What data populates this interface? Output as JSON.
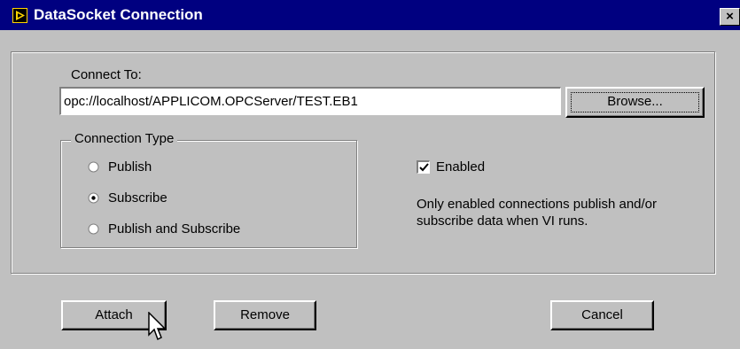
{
  "window": {
    "title": "DataSocket Connection",
    "close_glyph": "×",
    "icon": "labview-icon"
  },
  "connect": {
    "label": "Connect To:",
    "url_value": "opc://localhost/APPLICOM.OPCServer/TEST.EB1",
    "browse_label": "Browse..."
  },
  "connection_type": {
    "legend": "Connection Type",
    "options": [
      {
        "label": "Publish",
        "selected": false
      },
      {
        "label": "Subscribe",
        "selected": true
      },
      {
        "label": "Publish and Subscribe",
        "selected": false
      }
    ]
  },
  "enabled": {
    "label": "Enabled",
    "checked": true,
    "description_line1": "Only enabled connections publish and/or",
    "description_line2": "subscribe data when VI runs."
  },
  "buttons": {
    "attach": "Attach",
    "remove": "Remove",
    "cancel": "Cancel"
  },
  "colors": {
    "titlebar": "#000080",
    "dialog": "#c0c0c0"
  }
}
